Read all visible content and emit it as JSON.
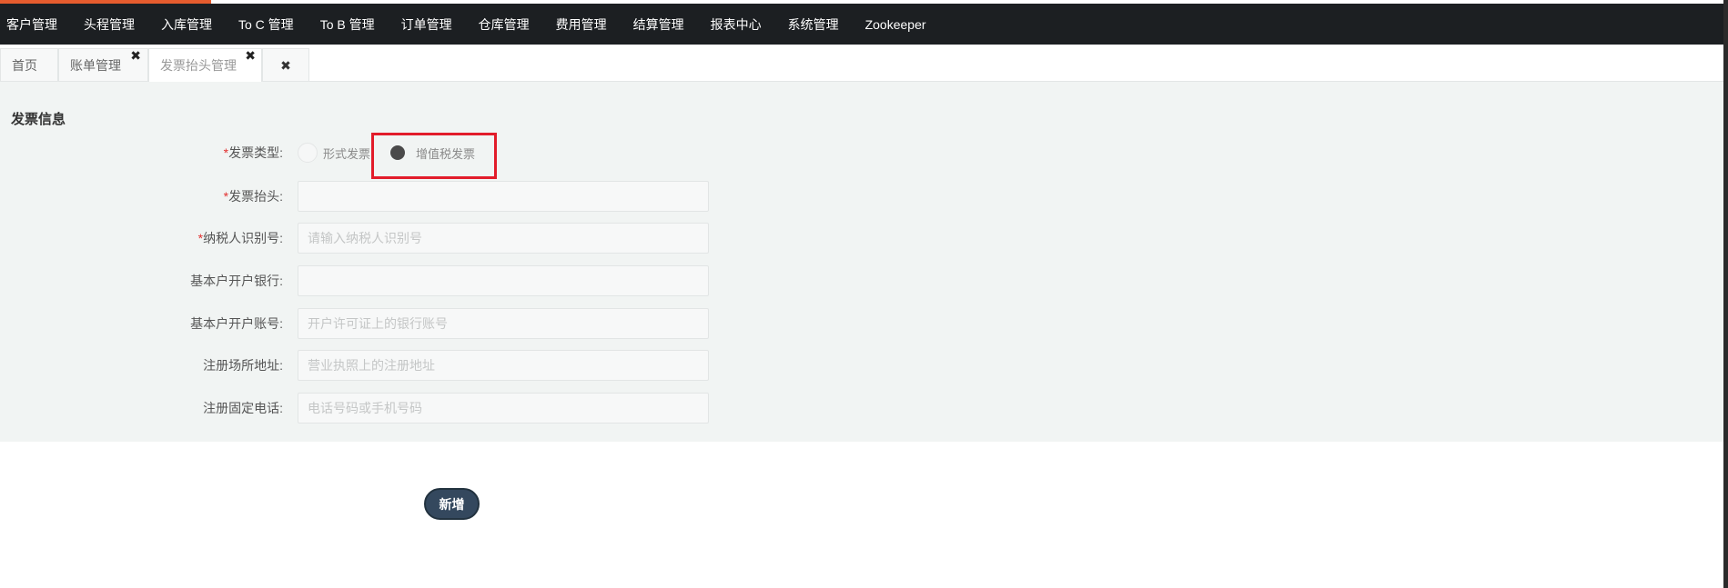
{
  "topnav": {
    "items": [
      {
        "label": "客户管理"
      },
      {
        "label": "头程管理"
      },
      {
        "label": "入库管理"
      },
      {
        "label": "To C 管理"
      },
      {
        "label": "To B 管理"
      },
      {
        "label": "订单管理"
      },
      {
        "label": "仓库管理"
      },
      {
        "label": "费用管理"
      },
      {
        "label": "结算管理"
      },
      {
        "label": "报表中心"
      },
      {
        "label": "系统管理"
      },
      {
        "label": "Zookeeper"
      }
    ]
  },
  "tabs": {
    "items": [
      {
        "label": "首页"
      },
      {
        "label": "账单管理",
        "close": "✖"
      },
      {
        "label": "发票抬头管理",
        "close": "✖"
      }
    ],
    "close_all": "✖"
  },
  "form": {
    "section_title": "发票信息",
    "required_mark": "*",
    "invoice_type": {
      "label": "发票类型:",
      "options": [
        {
          "label": "形式发票",
          "checked": false
        },
        {
          "label": "增值税发票",
          "checked": true
        }
      ]
    },
    "invoice_title": {
      "label": "发票抬头:",
      "value": "",
      "placeholder": ""
    },
    "taxpayer_id": {
      "label": "纳税人识别号:",
      "value": "",
      "placeholder": "请输入纳税人识别号"
    },
    "bank_name": {
      "label": "基本户开户银行:",
      "value": "",
      "placeholder": ""
    },
    "bank_account": {
      "label": "基本户开户账号:",
      "value": "",
      "placeholder": "开户许可证上的银行账号"
    },
    "address": {
      "label": "注册场所地址:",
      "value": "",
      "placeholder": "营业执照上的注册地址"
    },
    "phone": {
      "label": "注册固定电话:",
      "value": "",
      "placeholder": "电话号码或手机号码"
    },
    "add_button": "新增"
  },
  "colors": {
    "accent": "#e65c2e",
    "nav_bg": "#1c1f22",
    "highlight": "#e21c2a",
    "button_bg": "#34485e"
  }
}
